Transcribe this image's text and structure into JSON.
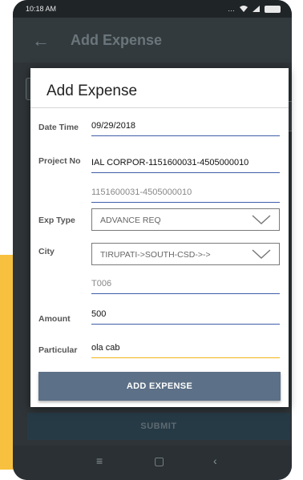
{
  "status_bar": {
    "time": "10:18 AM"
  },
  "app_bar": {
    "title": "Add Expense"
  },
  "dialog": {
    "title": "Add Expense",
    "fields": {
      "date_time": {
        "label": "Date Time",
        "value": "09/29/2018"
      },
      "project_no": {
        "label": "Project No",
        "value": "IAL CORPOR-1151600031-4505000010",
        "secondary": "1151600031-4505000010"
      },
      "exp_type": {
        "label": "Exp Type",
        "value": "ADVANCE REQ"
      },
      "city": {
        "label": "City",
        "value": "TIRUPATI->SOUTH-CSD->->",
        "secondary": "T006"
      },
      "amount": {
        "label": "Amount",
        "value": "500"
      },
      "particular": {
        "label": "Particular",
        "value": "ola cab"
      }
    },
    "add_button": "ADD EXPENSE"
  },
  "submit_button": "SUBMIT",
  "colors": {
    "accent": "#3f5ea8",
    "active_underline": "#f2b51a",
    "button": "#5c7087",
    "yellow": "#f7c13f"
  }
}
